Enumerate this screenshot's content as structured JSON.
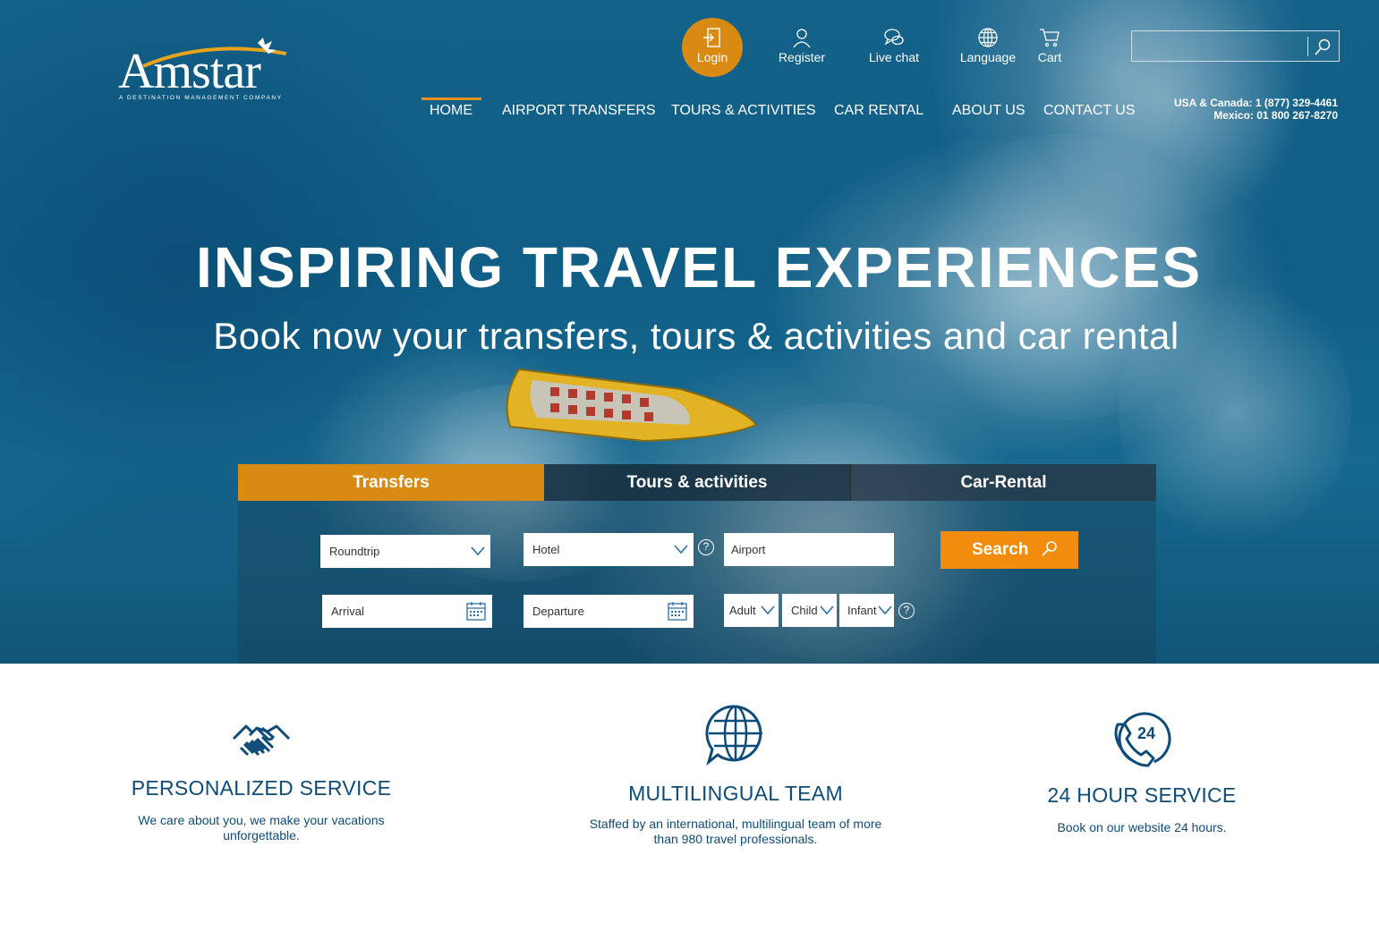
{
  "brand": {
    "name": "Amstar",
    "tagline": "A DESTINATION MANAGEMENT COMPANY"
  },
  "topmenu": {
    "login": "Login",
    "register": "Register",
    "live_chat": "Live chat",
    "language": "Language",
    "cart": "Cart"
  },
  "search": {
    "placeholder": ""
  },
  "nav": {
    "items": [
      "HOME",
      "AIRPORT TRANSFERS",
      "TOURS & ACTIVITIES",
      "CAR RENTAL",
      "ABOUT US",
      "CONTACT US"
    ],
    "active": "HOME"
  },
  "contact": {
    "usa": "USA & Canada: 1 (877) 329-4461",
    "mexico": "Mexico: 01 800 267-8270"
  },
  "hero": {
    "headline": "INSPIRING TRAVEL EXPERIENCES",
    "subline": "Book now your transfers, tours & activities and car rental"
  },
  "booking": {
    "tabs": [
      "Transfers",
      "Tours & activities",
      "Car-Rental"
    ],
    "active_tab": "Transfers",
    "trip_type": "Roundtrip",
    "from": "Hotel",
    "to": "Airport",
    "arrival": "Arrival",
    "departure": "Departure",
    "adult": "Adult",
    "child": "Child",
    "infant": "Infant",
    "help": "?",
    "search_label": "Search"
  },
  "features": [
    {
      "icon": "handshake-icon",
      "title": "PERSONALIZED SERVICE",
      "desc_line1": "We care about you, we make your vacations",
      "desc_line2": "unforgettable."
    },
    {
      "icon": "globe-chat-icon",
      "title": "MULTILINGUAL TEAM",
      "desc_line1": "Staffed by an international, multilingual team of more",
      "desc_line2": "than 980 travel professionals."
    },
    {
      "icon": "phone-24-icon",
      "title": "24 HOUR SERVICE",
      "desc_line1": "Book on our website 24 hours.",
      "desc_line2": ""
    }
  ],
  "colors": {
    "accent": "#d98a12",
    "search_button": "#f28c0f",
    "feature_text": "#0d4c7a"
  }
}
